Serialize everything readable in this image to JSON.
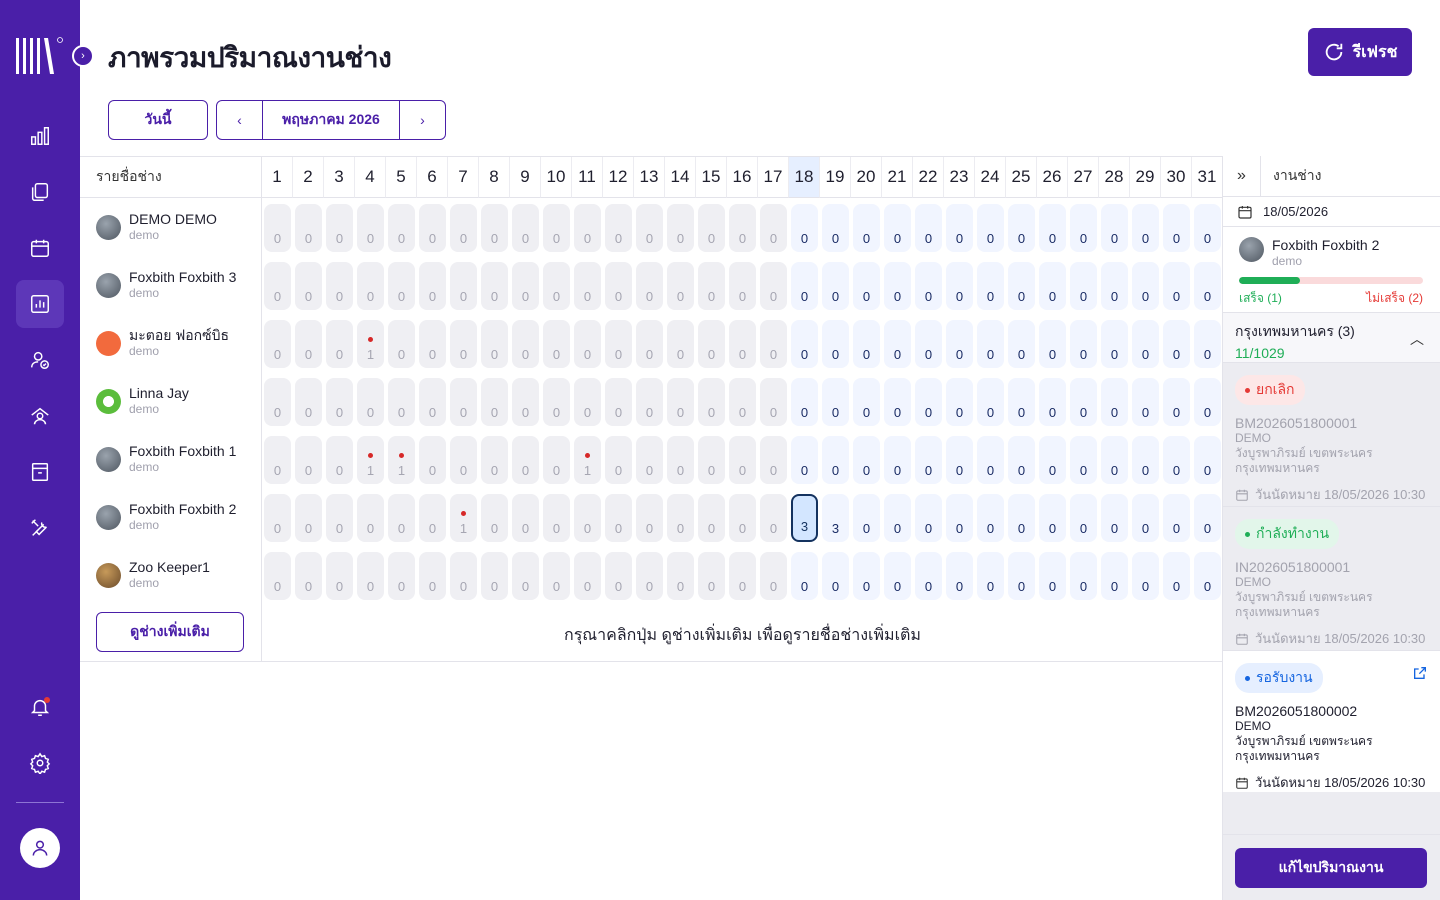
{
  "app": {
    "title": "ภาพรวมปริมาณงานช่าง",
    "refresh_label": "รีเฟรช"
  },
  "toolbar": {
    "today_label": "วันนี้",
    "month_label": "พฤษภาคม 2026"
  },
  "grid": {
    "name_header": "รายชื่อช่าง",
    "days": [
      "1",
      "2",
      "3",
      "4",
      "5",
      "6",
      "7",
      "8",
      "9",
      "10",
      "11",
      "12",
      "13",
      "14",
      "15",
      "16",
      "17",
      "18",
      "19",
      "20",
      "21",
      "22",
      "23",
      "24",
      "25",
      "26",
      "27",
      "28",
      "29",
      "30",
      "31"
    ],
    "today_day": 18,
    "selected": {
      "row": 5,
      "day": 18
    },
    "technicians": [
      {
        "name": "DEMO DEMO",
        "sub": "demo",
        "avatar": "photo-avatar",
        "counts": [
          0,
          0,
          0,
          0,
          0,
          0,
          0,
          0,
          0,
          0,
          0,
          0,
          0,
          0,
          0,
          0,
          0,
          0,
          0,
          0,
          0,
          0,
          0,
          0,
          0,
          0,
          0,
          0,
          0,
          0,
          0
        ],
        "alerts": []
      },
      {
        "name": "Foxbith Foxbith 3",
        "sub": "demo",
        "avatar": "photo-avatar",
        "counts": [
          0,
          0,
          0,
          0,
          0,
          0,
          0,
          0,
          0,
          0,
          0,
          0,
          0,
          0,
          0,
          0,
          0,
          0,
          0,
          0,
          0,
          0,
          0,
          0,
          0,
          0,
          0,
          0,
          0,
          0,
          0
        ],
        "alerts": []
      },
      {
        "name": "มะตอย ฟอกซ์บิธ",
        "sub": "demo",
        "avatar": "orange-avatar",
        "counts": [
          0,
          0,
          0,
          1,
          0,
          0,
          0,
          0,
          0,
          0,
          0,
          0,
          0,
          0,
          0,
          0,
          0,
          0,
          0,
          0,
          0,
          0,
          0,
          0,
          0,
          0,
          0,
          0,
          0,
          0,
          0
        ],
        "alerts": [
          4
        ]
      },
      {
        "name": "Linna Jay",
        "sub": "demo",
        "avatar": "green-avatar",
        "counts": [
          0,
          0,
          0,
          0,
          0,
          0,
          0,
          0,
          0,
          0,
          0,
          0,
          0,
          0,
          0,
          0,
          0,
          0,
          0,
          0,
          0,
          0,
          0,
          0,
          0,
          0,
          0,
          0,
          0,
          0,
          0
        ],
        "alerts": []
      },
      {
        "name": "Foxbith Foxbith 1",
        "sub": "demo",
        "avatar": "photo-avatar",
        "counts": [
          0,
          0,
          0,
          1,
          1,
          0,
          0,
          0,
          0,
          0,
          1,
          0,
          0,
          0,
          0,
          0,
          0,
          0,
          0,
          0,
          0,
          0,
          0,
          0,
          0,
          0,
          0,
          0,
          0,
          0,
          0
        ],
        "alerts": [
          4,
          5,
          11
        ]
      },
      {
        "name": "Foxbith Foxbith 2",
        "sub": "demo",
        "avatar": "photo-avatar",
        "counts": [
          0,
          0,
          0,
          0,
          0,
          0,
          1,
          0,
          0,
          0,
          0,
          0,
          0,
          0,
          0,
          0,
          0,
          3,
          3,
          0,
          0,
          0,
          0,
          0,
          0,
          0,
          0,
          0,
          0,
          0,
          0
        ],
        "alerts": [
          7
        ]
      },
      {
        "name": "Zoo Keeper1",
        "sub": "demo",
        "avatar": "brown-avatar",
        "counts": [
          0,
          0,
          0,
          0,
          0,
          0,
          0,
          0,
          0,
          0,
          0,
          0,
          0,
          0,
          0,
          0,
          0,
          0,
          0,
          0,
          0,
          0,
          0,
          0,
          0,
          0,
          0,
          0,
          0,
          0,
          0
        ],
        "alerts": []
      }
    ],
    "more_label": "ดูช่างเพิ่มเติม",
    "hint": "กรุณาคลิกปุ่ม ดูช่างเพิ่มเติม เพื่อดูรายชื่อช่างเพิ่มเติม"
  },
  "panel": {
    "collapse_icon": "double-chevron-right-icon",
    "title": "งานช่าง",
    "date": "18/05/2026",
    "tech_name": "Foxbith Foxbith 2",
    "tech_sub": "demo",
    "progress_fraction": 0.33,
    "done_label": "เสร็จ (1)",
    "not_done_label": "ไม่เสร็จ (2)",
    "region_title": "กรุงเทพมหานคร (3)",
    "region_count": "11/1029",
    "jobs": [
      {
        "status": "ยกเลิก",
        "status_color": "#e53935",
        "status_bg": "#fde7e7",
        "id": "BM2026051800001",
        "customer": "DEMO",
        "address1": "วังบูรพาภิรมย์ เขตพระนคร",
        "address2": "กรุงเทพมหานคร",
        "appointment": "วันนัดหมาย 18/05/2026 10:30",
        "dim": true
      },
      {
        "status": "กำลังทำงาน",
        "status_color": "#1fae57",
        "status_bg": "#e2f6ea",
        "id": "IN2026051800001",
        "customer": "DEMO",
        "address1": "วังบูรพาภิรมย์ เขตพระนคร",
        "address2": "กรุงเทพมหานคร",
        "appointment": "วันนัดหมาย 18/05/2026 10:30",
        "dim": true
      },
      {
        "status": "รอรับงาน",
        "status_color": "#1565e0",
        "status_bg": "#e6efff",
        "id": "BM2026051800002",
        "customer": "DEMO",
        "address1": "วังบูรพาภิรมย์ เขตพระนคร",
        "address2": "กรุงเทพมหานคร",
        "appointment": "วันนัดหมาย 18/05/2026 10:30",
        "dim": false
      }
    ],
    "edit_label": "แก้ไขปริมาณงาน"
  },
  "colors": {
    "brand": "#4a1fa8",
    "success": "#1fae57",
    "danger": "#e53935",
    "info": "#1565e0"
  }
}
